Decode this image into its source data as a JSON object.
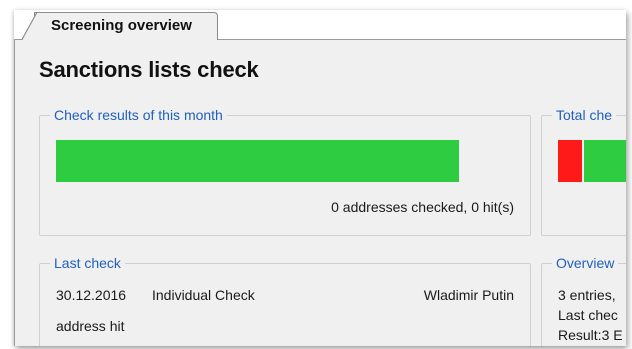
{
  "tabs": [
    {
      "label": "Screening overview",
      "selected": true
    }
  ],
  "page_title": "Sanctions lists check",
  "colors": {
    "legend_text": "#1f5fbf",
    "bar_green": "#2ecc40",
    "bar_red": "#ff1a1a"
  },
  "month_panel": {
    "legend": "Check results of this month",
    "summary": "0 addresses checked, 0 hit(s)",
    "ok_fraction": 1.0
  },
  "total_panel": {
    "legend": "Total che",
    "hit_fraction_visible": 0.28
  },
  "last_check_panel": {
    "legend": "Last check",
    "date": "30.12.2016",
    "type": "Individual Check",
    "name": "Wladimir Putin",
    "result": "address hit"
  },
  "overview_panel": {
    "legend": "Overview",
    "lines": [
      "3 entries, ",
      "Last chec",
      "Result:3 E"
    ]
  }
}
